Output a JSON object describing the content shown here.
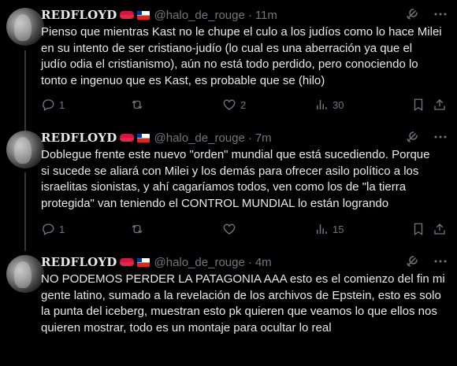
{
  "tweets": [
    {
      "name": "REDFLOYD",
      "handle": "@halo_de_rouge",
      "sep": "·",
      "time": "11m",
      "text": "Pienso que mientras Kast no le chupe el culo a los judíos como lo hace Milei\nen su intento de ser cristiano-judío (lo cual es una aberración ya que el\njudío odia el cristianismo), aún no está todo perdido, pero conociendo lo\ntonto e ingenuo que es Kast, es probable que se (hilo)",
      "replies": "1",
      "retweets": "",
      "likes": "2",
      "views": "30"
    },
    {
      "name": "REDFLOYD",
      "handle": "@halo_de_rouge",
      "sep": "·",
      "time": "7m",
      "text": "Doblegue frente este nuevo \"orden\" mundial que está sucediendo. Porque\nsi sucede se aliará con Milei y los demás para ofrecer asilo político a los\nisraelitas sionistas, y ahí cagaríamos todos, ven como los de \"la tierra\nprotegida\" van teniendo el CONTROL MUNDIAL lo están logrando",
      "replies": "1",
      "retweets": "",
      "likes": "",
      "views": "15"
    },
    {
      "name": "REDFLOYD",
      "handle": "@halo_de_rouge",
      "sep": "·",
      "time": "4m",
      "text": "NO PODEMOS PERDER LA PATAGONIA AAA esto es el comienzo del fin mi\ngente latino, sumado a la revelación de los archivos de Epstein, esto es solo\nla punta del iceberg, muestran esto pk quieren que veamos lo que ellos nos\nquieren mostrar, todo es un montaje para ocultar lo real",
      "replies": "",
      "retweets": "",
      "likes": "",
      "views": ""
    }
  ],
  "icons": {
    "grok": "grok-icon",
    "more": "more-icon",
    "reply": "reply-icon",
    "retweet": "retweet-icon",
    "like": "like-icon",
    "views": "views-icon",
    "bookmark": "bookmark-icon",
    "share": "share-icon"
  },
  "colors": {
    "background": "#000000",
    "text": "#e7e9ea",
    "secondary": "#71767b",
    "thread_line": "#333639"
  }
}
